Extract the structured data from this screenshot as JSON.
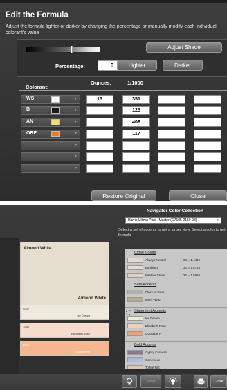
{
  "formula": {
    "title": "Edit the Formula",
    "description": "Adjust the formula lighter or darker by changing the percentage or manually modify each individual colorant's value",
    "shade_level": 0.62,
    "adjust_shade_label": "Adjust Shade",
    "percentage_label": "Percentage:",
    "percentage_value": "0",
    "lighter_label": "Lighter",
    "darker_label": "Darker",
    "col_colorant": "Colorant:",
    "col_ounces": "Ounces:",
    "col_ratio": "1/1000",
    "rows": [
      {
        "code": "WS",
        "swatch": "#ffffff",
        "ounces": "15",
        "parts": "351"
      },
      {
        "code": "B",
        "swatch": "#1a1a1a",
        "ounces": "",
        "parts": "125"
      },
      {
        "code": "AN",
        "swatch": "#f0e25a",
        "ounces": "",
        "parts": "406"
      },
      {
        "code": "ORE",
        "swatch": "#f07d1a",
        "ounces": "",
        "parts": "117"
      },
      {
        "code": "",
        "swatch": "",
        "ounces": "",
        "parts": ""
      },
      {
        "code": "",
        "swatch": "",
        "ounces": "",
        "parts": ""
      },
      {
        "code": "",
        "swatch": "",
        "ounces": "",
        "parts": ""
      }
    ],
    "restore_label": "Restore Original",
    "close_label": "Close"
  },
  "navigator": {
    "title": "Navigator Color Collection",
    "collection_value": "Harris Ultima Plus - Master (G7105-2159-08)",
    "description": "Select a set of accents to get a larger view. Select a color to get formula.",
    "selected_color": {
      "name": "Almond White",
      "hex": "#e5ddcd"
    },
    "swatches": [
      {
        "code": "0032",
        "name": "Ice Dream",
        "hex": "#eeeae0"
      },
      {
        "code": "1056",
        "name": "Elizabeth Rose",
        "hex": "#f6dccc"
      },
      {
        "code": "0074",
        "name": "Gooseberry",
        "hex": "#f7b78e"
      }
    ],
    "groups": [
      {
        "title": "Close Colors",
        "items": [
          {
            "name": "Always Neutral",
            "hex": "#e2d9c8",
            "de": "DE = 1.4446"
          },
          {
            "name": "Earthling",
            "hex": "#e7dcc6",
            "de": "DE = 1.5725"
          },
          {
            "name": "Feather Stone",
            "hex": "#ddd2bd",
            "de": "DE = 1.5866"
          }
        ]
      },
      {
        "title": "Safe Accents",
        "items": [
          {
            "name": "Place of Dust",
            "hex": "#b0b0a8",
            "de": ""
          },
          {
            "name": "Moth Wing",
            "hex": "#b8a88e",
            "de": ""
          }
        ]
      },
      {
        "title": "Statement Accents",
        "items": [
          {
            "name": "Ice Dream",
            "hex": "#eeeae0",
            "de": ""
          },
          {
            "name": "Elizabeth Rose",
            "hex": "#f2cfb8",
            "de": ""
          },
          {
            "name": "Gooseberry",
            "hex": "#f2a071",
            "de": ""
          }
        ]
      },
      {
        "title": "Bold Accents",
        "items": [
          {
            "name": "Gypsy Caravan",
            "hex": "#8a7a95",
            "de": ""
          },
          {
            "name": "Genevieve",
            "hex": "#a8bdd8",
            "de": ""
          },
          {
            "name": "Toffee Tint",
            "hex": "#d8c6b2",
            "de": ""
          }
        ]
      }
    ],
    "toolbar": {
      "reset_label": "Reset",
      "close_label": "Close"
    }
  }
}
